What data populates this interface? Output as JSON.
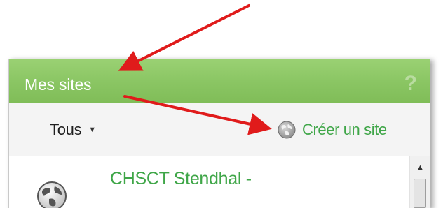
{
  "widget": {
    "title": "Mes sites",
    "help_symbol": "?",
    "filter_label": "Tous",
    "filter_caret": "▼",
    "create_label": "Créer un site",
    "scroll_up_symbol": "▲",
    "sites": [
      {
        "name": "CHSCT Stendhal -"
      }
    ]
  },
  "icons": {
    "help": "help-icon",
    "caret": "caret-down-icon",
    "create": "globe-icon",
    "site": "globe-icon",
    "scroll_up": "scroll-up-icon"
  },
  "colors": {
    "header_green": "#8bc664",
    "link_green": "#3fa648",
    "arrow_red": "#e01b1b",
    "toolbar_bg": "#f4f4f4"
  }
}
